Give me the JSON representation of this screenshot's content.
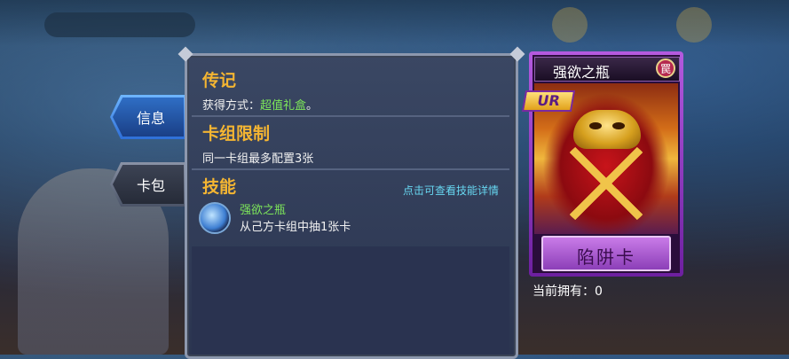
{
  "tabs": [
    {
      "label": "信息",
      "active": true
    },
    {
      "label": "卡包",
      "active": false
    }
  ],
  "legend": {
    "title": "传记",
    "obtain_label": "获得方式：",
    "obtain_value": "超值礼盒",
    "obtain_suffix": "。"
  },
  "deck_limit": {
    "title": "卡组限制",
    "text": "同一卡组最多配置3张"
  },
  "skill": {
    "title": "技能",
    "detail_link": "点击可查看技能详情",
    "name": "强欲之瓶",
    "description": "从己方卡组中抽1张卡"
  },
  "card": {
    "name": "强欲之瓶",
    "attribute": "罠",
    "rarity": "UR",
    "type_label": "陷阱卡",
    "frame_color": "#b45adf"
  },
  "owned": {
    "label": "当前拥有：",
    "value": "0"
  },
  "colors": {
    "title_gold": "#f4b532",
    "highlight_green": "#7de65a",
    "link_cyan": "#67d6f0"
  }
}
